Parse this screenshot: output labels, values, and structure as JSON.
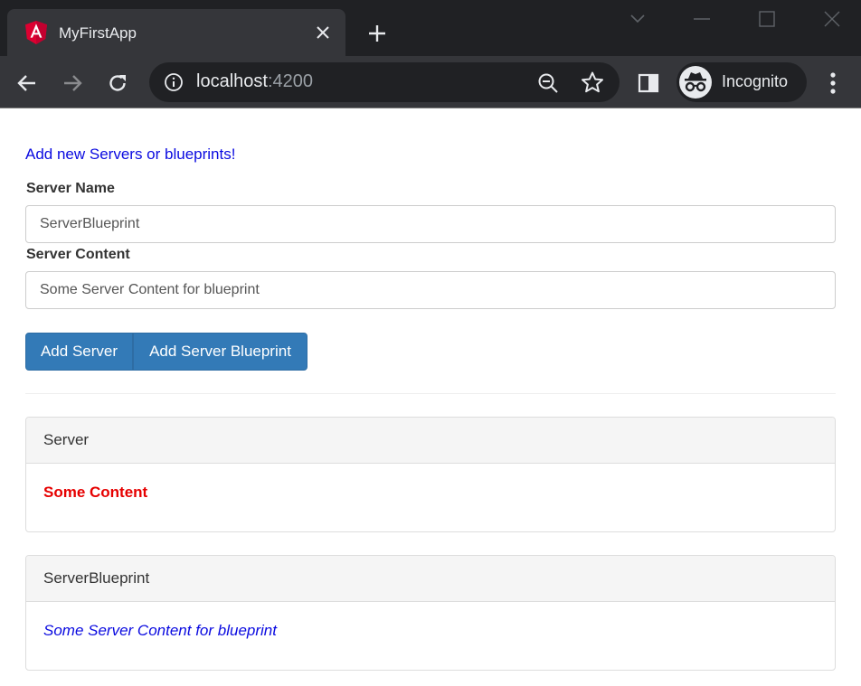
{
  "browser": {
    "tab_title": "MyFirstApp",
    "url_host": "localhost",
    "url_port": ":4200",
    "profile_label": "Incognito",
    "colors": {
      "chrome_dark": "#202124",
      "chrome_toolbar": "#35363a",
      "angular_red": "#dd0031"
    }
  },
  "page": {
    "intro_text": "Add new Servers or blueprints!",
    "server_name_label": "Server Name",
    "server_name_value": "ServerBlueprint",
    "server_content_label": "Server Content",
    "server_content_value": "Some Server Content for blueprint",
    "add_server_label": "Add Server",
    "add_blueprint_label": "Add Server Blueprint",
    "colors": {
      "primary_button": "#337ab7",
      "server_content": "#e60000",
      "blueprint_content": "#0a0ae0"
    }
  },
  "servers": [
    {
      "type": "server",
      "name": "Server",
      "content": "Some Content"
    },
    {
      "type": "blueprint",
      "name": "ServerBlueprint",
      "content": "Some Server Content for blueprint"
    }
  ]
}
